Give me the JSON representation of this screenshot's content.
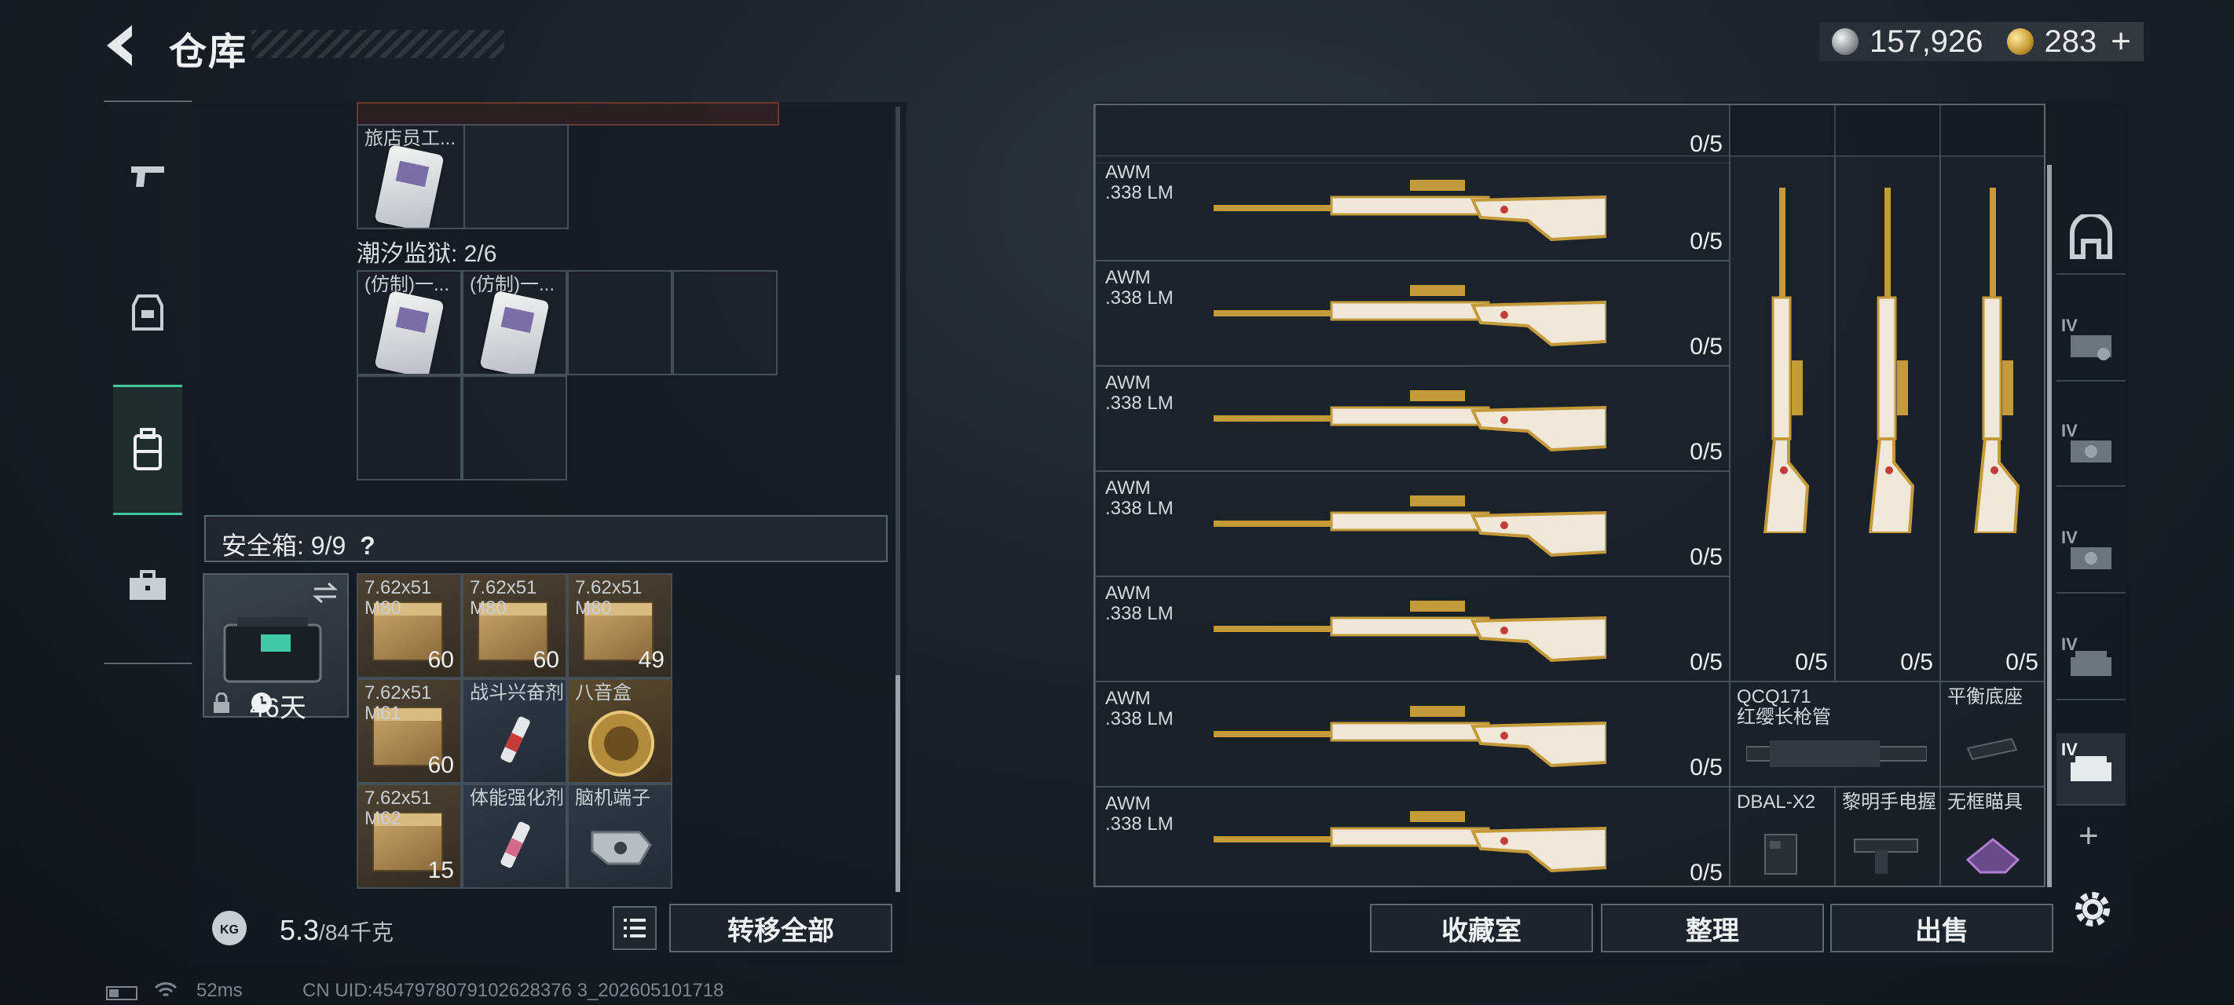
{
  "header": {
    "title": "仓库",
    "silver_coins": "157,926",
    "gold_coins": "283",
    "gold_plus": "+"
  },
  "left_top": {
    "partial_slot_label": "旅店员工...",
    "prison_label": "潮汐监狱: 2/6",
    "prison_items": [
      "(仿制)一...",
      "(仿制)一..."
    ]
  },
  "safe_box": {
    "label": "安全箱: 9/9",
    "help": "?",
    "days": "46天",
    "items": [
      {
        "label": "7.62x51\nM80",
        "count": "60",
        "kind": "ammo"
      },
      {
        "label": "7.62x51\nM80",
        "count": "60",
        "kind": "ammo"
      },
      {
        "label": "7.62x51\nM80",
        "count": "49",
        "kind": "ammo"
      },
      {
        "label": "7.62x51\nM61",
        "count": "60",
        "kind": "ammo"
      },
      {
        "label": "战斗兴奋剂",
        "count": "",
        "kind": "syringe"
      },
      {
        "label": "八音盒",
        "count": "",
        "kind": "musicbox"
      },
      {
        "label": "7.62x51\nM62",
        "count": "15",
        "kind": "ammo"
      },
      {
        "label": "体能强化剂",
        "count": "",
        "kind": "syringe"
      },
      {
        "label": "脑机端子",
        "count": "",
        "kind": "device"
      }
    ]
  },
  "capacity": {
    "current": "5.3",
    "max": "/84千克",
    "kg_label": "KG"
  },
  "buttons": {
    "transfer_all": "转移全部",
    "collection": "收藏室",
    "organize": "整理",
    "sell": "出售"
  },
  "right_grid": {
    "top_partial_durability": "0/5",
    "guns": [
      {
        "name": "AWM\n.338 LM",
        "durability": "0/5"
      },
      {
        "name": "AWM\n.338 LM",
        "durability": "0/5"
      },
      {
        "name": "AWM\n.338 LM",
        "durability": "0/5"
      },
      {
        "name": "AWM\n.338 LM",
        "durability": "0/5"
      },
      {
        "name": "AWM\n.338 LM",
        "durability": "0/5"
      },
      {
        "name": "AWM\n.338 LM",
        "durability": "0/5"
      },
      {
        "name": "AWM\n.338 LM",
        "durability": "0/5"
      }
    ],
    "tall_guns": [
      {
        "durability": "0/5"
      },
      {
        "durability": "0/5"
      },
      {
        "durability": "0/5"
      }
    ],
    "attachments": [
      {
        "label": "QCQ171\n红缨长枪管"
      },
      {
        "label": "平衡底座"
      },
      {
        "label": "DBAL-X2"
      },
      {
        "label": "黎明手电握"
      },
      {
        "label": "无框瞄具"
      }
    ]
  },
  "right_rail": {
    "tiers": [
      "IV",
      "IV",
      "IV",
      "IV",
      "IV"
    ],
    "add": "+"
  },
  "status": {
    "ping": "52ms",
    "uid": "CN UID:4547978079102628376 3_202605101718"
  }
}
